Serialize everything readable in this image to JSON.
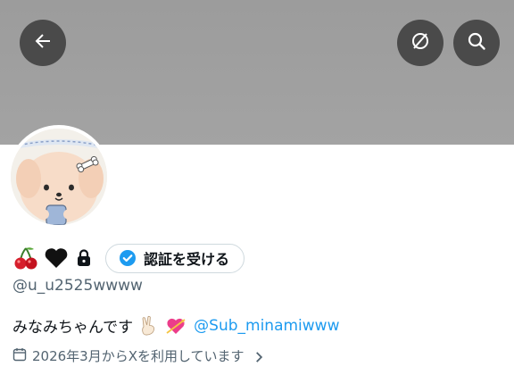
{
  "header": {
    "back_icon": "arrow-left-icon",
    "grok_icon": "grok-icon",
    "search_icon": "search-icon",
    "banner_color": "#9e9e9e"
  },
  "profile": {
    "avatar_desc": "cartoon-puppy-avatar",
    "name_emojis": [
      "cherry-emoji",
      "black-heart-emoji"
    ],
    "protected_icon": "lock-icon",
    "verify_label": "認証を受ける",
    "handle": "@u_u2525wwww",
    "bio_text": "みなみちゃんです",
    "bio_emojis": [
      "victory-hand-emoji",
      "heart-with-arrow-emoji"
    ],
    "bio_mention": "@Sub_minamiwww",
    "joined_text": "2026年3月からXを利用しています",
    "accent_color": "#1d9bf0"
  }
}
